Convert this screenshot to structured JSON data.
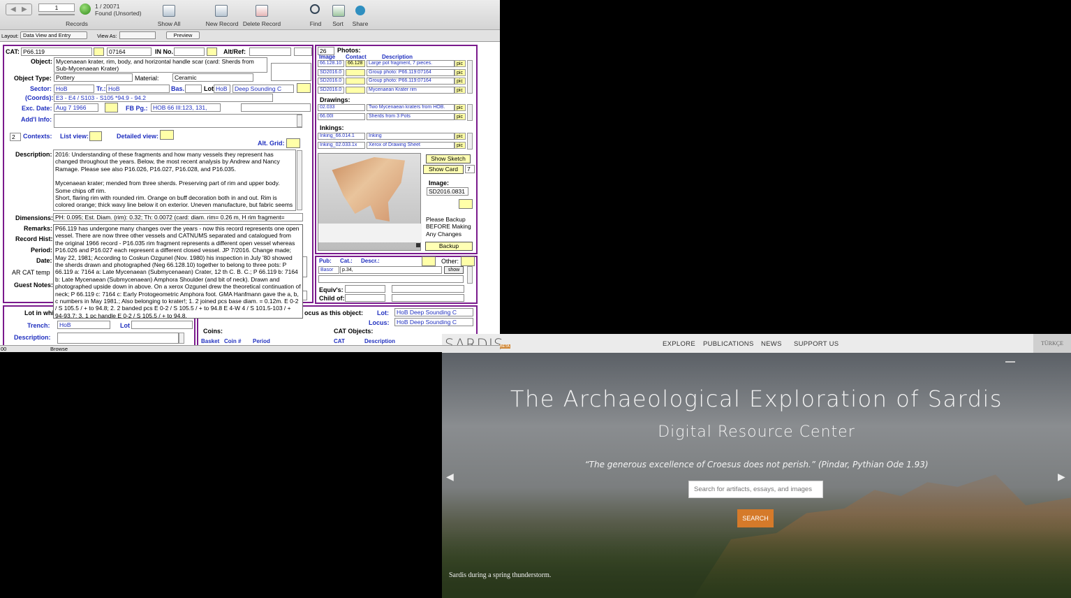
{
  "toolbar": {
    "record_pos": "1",
    "record_count": "1 / 20071",
    "found": "Found (Unsorted)",
    "records": "Records",
    "show_all": "Show All",
    "new_record": "New Record",
    "delete_record": "Delete Record",
    "find": "Find",
    "sort": "Sort",
    "share": "Share"
  },
  "layoutbar": {
    "layout_label": "Layout:",
    "layout_value": "Data View and Entry",
    "view_as": "View As:",
    "preview": "Preview"
  },
  "status": {
    "zoom": "00",
    "mode": "Browse"
  },
  "record": {
    "cat_label": "CAT:",
    "cat": "P66.119",
    "cat2": "07164",
    "in_no_label": "IN No.",
    "altref_label": "Alt/Ref:",
    "object_label": "Object:",
    "object": "Mycenaean krater, rim, body, and horizontal handle scar (card: Sherds from Sub-Mycenaean Krater)",
    "type_label": "Object Type:",
    "type": "Pottery",
    "material_label": "Material:",
    "material": "Ceramic",
    "sector_label": "Sector:",
    "sector": "HoB",
    "tr_label": "Tr.:",
    "tr": "HoB",
    "bas_label": "Bas.",
    "lot_label": "Lot",
    "lot": "HoB",
    "lot2": "Deep Sounding C",
    "coords_label": "(Coords):",
    "coords": "E3 - E4 / S103 - S105   *94.9 - 94.2",
    "exc_label": "Exc. Date:",
    "exc": "Aug 7 1966",
    "fb_label": "FB Pg.:",
    "fb": "HOB 66 III:123, 131,",
    "addl_label": "Add'l Info:",
    "contexts_num": "2",
    "contexts_label": "Contexts:",
    "listview_label": "List view:",
    "detailed_label": "Detailed view:",
    "altgrid_label": "Alt. Grid:",
    "desc_label": "Description:",
    "desc1": "2016: Understanding of these fragments and how many vessels they represent has changed throughout the years. Below, the most recent analysis by Andrew and Nancy Ramage. Please see also P16.026, P16.027, P16.028, and P16.035.",
    "desc2": "Mycenaean krater; mended from three sherds. Preserving part of rim and upper body. Some chips off rim.",
    "desc3": "Short, flaring rim with rounded rim. Orange on buff decoration both in and out. Rim is colored orange; thick wavy line below it on exterior. Uneven manufacture, but fabric seems fine and sturdy. Hand-fired with occasional breaks. Some mica.",
    "dim_label": "Dimensions:",
    "dim": "PH: 0.095; Est. Diam. (rim): 0.32; Th: 0.0072  (card: diam. rim= 0.26 m, H rim fragment=",
    "remarks_label": "Remarks:",
    "rechist_label": "Record Hist:",
    "period_label": "Period:",
    "date_label": "Date:",
    "arcat_label": "AR CAT temp",
    "guest_label": "Guest Notes:",
    "remarks": "P66.119 has undergone many changes over the years - now this record represents one open vessel. There are now three other vessels and CATNUMS separated and catalogued from the original 1966 record - P16.035 rim fragment represents a different open vessel whereas P16.026 and P16.027 each represent a different closed vessel. JP 7/2016. Change made; May 22, 1981; According to Coskun Ozgunel (Nov. 1980) his inspection in July '80 showed the sherds drawn and photographed (Neg 66.128.10) together to belong to three pots: P 66.119 a: 7164 a: Late Mycenaean (Submycenaean) Crater, 12 th C. B. C.; P 66.119 b: 7164 b: Late Mycenaean (Submycenaean) Amphora Shoulder (and bit of neck). Drawn and photographed upside down in above. On a xerox Ozgunel drew the theoretical continuation of neck; P 66.119 c: 7164 c: Early Protogeometric Amphora foot. GMA Hanfmann gave the a, b, c numbers in May 1981.; Also belonging to krater!; 1. 2 joined pcs base diam. = 0.12m. E 0-2 / S 105.5 / + to 94.8; 2. 2 banded pcs E 0-2 / S 105.5 / + to 94.8 E 4-W 4 / S 101.5-103 / + 94-93.7; 3. 1 pc handle E 0-2 / S 105.5 / + to 94.8.",
    "lotin_label": "Lot in whi",
    "locus_as_label": "ocus as this object:",
    "lot3_label": "Lot:",
    "lot3": "HoB Deep Sounding C",
    "locus_label": "Locus:",
    "locus": "HoB Deep Sounding C",
    "trench_label": "Trench:",
    "trench": "HoB",
    "lot4_label": "Lot",
    "desc4_label": "Description:",
    "coins_label": "Coins:",
    "basket_label": "Basket",
    "coin_label": "Coin #",
    "period2_label": "Period",
    "catobj_label": "CAT Objects:",
    "cat3_label": "CAT",
    "desc5_label": "Description"
  },
  "photos": {
    "count": "26",
    "title": "Photos:",
    "h_image": "Image",
    "h_contact": "Contact",
    "h_desc": "Description",
    "rows": [
      {
        "image": "66.128.10",
        "contact": "66.128",
        "desc": "Large pot fragment, 7 pieces."
      },
      {
        "image": "SD2016.0",
        "contact": "",
        "desc": "Group photo: P66.119:07164"
      },
      {
        "image": "SD2016.0",
        "contact": "",
        "desc": "Group photo: P66.119:07164"
      },
      {
        "image": "SD2016.0",
        "contact": "",
        "desc": "Mycenaean Krater rim"
      }
    ],
    "pic": "pic",
    "drawings_title": "Drawings:",
    "drawings": [
      {
        "id": "02.033",
        "desc": "Two Mycenaean kraters from HOB."
      },
      {
        "id": "66.00I",
        "desc": "Sherds from 3 Pots"
      }
    ],
    "inkings_title": "Inkings:",
    "inkings": [
      {
        "id": "Inking_66.014.1",
        "desc": "Inking"
      },
      {
        "id": "Inking_02.033.1x",
        "desc": "Xerox of Drawing Sheet"
      }
    ],
    "show_sketch": "Show Sketch",
    "show_card": "Show Card",
    "card_num": "7",
    "image_label": "Image:",
    "image_value": "SD2016.0831",
    "backup_note": "Please Backup BEFORE Making Any Changes",
    "backup": "Backup"
  },
  "pub": {
    "pub_label": "Pub:",
    "cat_label": "Cat.:",
    "descr_label": "Descr.:",
    "other_label": "Other:",
    "pub_value": "Basor",
    "cat_value": "p.34,",
    "show": "show",
    "equiv_label": "Equiv's:",
    "child_label": "Child of:"
  },
  "sardis": {
    "logo": "SARDIS",
    "beta": "BETA",
    "nav": [
      "EXPLORE",
      "PUBLICATIONS",
      "NEWS",
      "SUPPORT US"
    ],
    "lang": "TÜRKÇE",
    "title": "The Archaeological Exploration of Sardis",
    "subtitle": "Digital Resource Center",
    "quote": "“The generous excellence of Croesus does not perish.” (Pindar, Pythian Ode 1.93)",
    "search_placeholder": "Search for artifacts, essays, and images",
    "search_button": "SEARCH",
    "caption": "Sardis during a spring thunderstorm.",
    "prev": "◀",
    "next": "▶"
  }
}
